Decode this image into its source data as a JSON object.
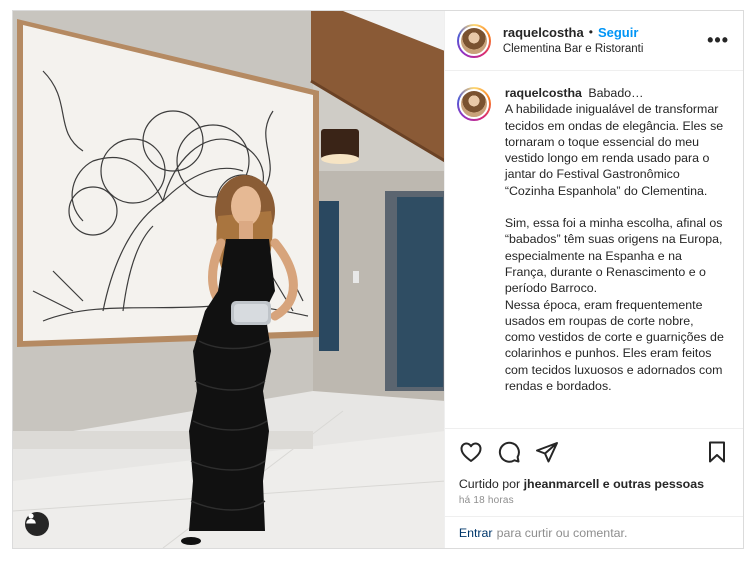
{
  "post": {
    "username": "raquelcostha",
    "separator": "•",
    "follow_label": "Seguir",
    "location": "Clementina Bar e Ristoranti",
    "more_label": "•••"
  },
  "caption": {
    "username": "raquelcostha",
    "paragraph1": "Babado…\nA habilidade inigualável de transformar tecidos em ondas de elegância. Eles se tornaram o toque essencial do meu vestido longo em renda usado para o jantar do Festival Gastronômico “Cozinha Espanhola” do Clementina.",
    "paragraph2": "Sim, essa foi a minha escolha, afinal os “babados” têm suas origens na Europa, especialmente na Espanha e na França, durante o Renascimento e o período Barroco.\nNessa época, eram frequentemente usados em roupas de corte nobre, como vestidos de corte e guarnições de colarinhos e punhos. Eles eram feitos com tecidos luxuosos e adornados com rendas e bordados."
  },
  "actions": {
    "like_icon": "heart-icon",
    "comment_icon": "comment-icon",
    "share_icon": "send-icon",
    "save_icon": "bookmark-icon"
  },
  "likes": {
    "prefix": "Curtido por",
    "user": "jheanmarcell",
    "suffix": "e outras pessoas"
  },
  "time": "há 18 horas",
  "login": {
    "link": "Entrar",
    "text": "para curtir ou comentar."
  },
  "colors": {
    "accent": "#0095f6",
    "text": "#262626",
    "muted": "#8e8e8e",
    "border": "#dbdbdb"
  }
}
